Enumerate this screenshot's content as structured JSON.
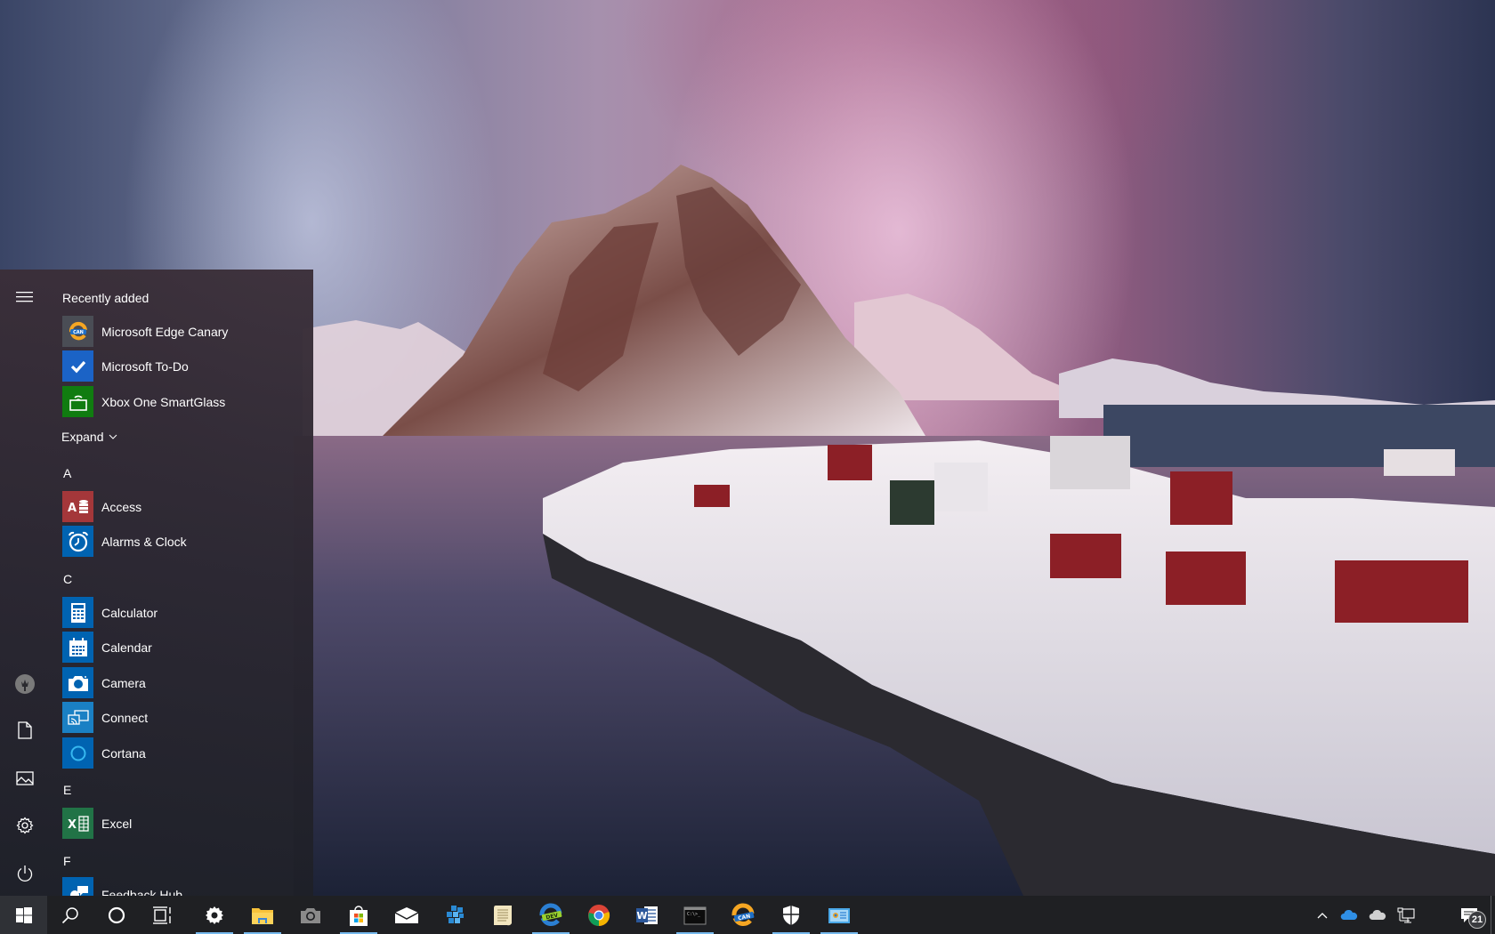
{
  "wallpaper": {
    "description": "Snowy mountain fishing village with red cabins at dusk under pink sky"
  },
  "start_menu": {
    "rail": [
      {
        "name": "menu",
        "icon": "hamburger-icon",
        "label": "Expand menu"
      },
      {
        "name": "user",
        "icon": "user-avatar-icon",
        "label": "User account"
      },
      {
        "name": "documents",
        "icon": "document-icon",
        "label": "Documents"
      },
      {
        "name": "pictures",
        "icon": "pictures-icon",
        "label": "Pictures"
      },
      {
        "name": "settings",
        "icon": "gear-icon",
        "label": "Settings"
      },
      {
        "name": "power",
        "icon": "power-icon",
        "label": "Power"
      }
    ],
    "recently_added_label": "Recently added",
    "recently_added": [
      {
        "label": "Microsoft Edge Canary",
        "icon": "edge-canary-icon",
        "tile_color": "#4a4d55"
      },
      {
        "label": "Microsoft To-Do",
        "icon": "checkmark-icon",
        "tile_color": "#1b63c6"
      },
      {
        "label": "Xbox One SmartGlass",
        "icon": "smartglass-icon",
        "tile_color": "#107c10"
      }
    ],
    "expand_label": "Expand",
    "groups": [
      {
        "letter": "A",
        "apps": [
          {
            "label": "Access",
            "icon": "access-icon",
            "tile_color": "#a4373a"
          },
          {
            "label": "Alarms & Clock",
            "icon": "alarm-clock-icon",
            "tile_color": "#0063b1"
          }
        ]
      },
      {
        "letter": "C",
        "apps": [
          {
            "label": "Calculator",
            "icon": "calculator-icon",
            "tile_color": "#0063b1"
          },
          {
            "label": "Calendar",
            "icon": "calendar-icon",
            "tile_color": "#0063b1"
          },
          {
            "label": "Camera",
            "icon": "camera-icon",
            "tile_color": "#0063b1"
          },
          {
            "label": "Connect",
            "icon": "connect-icon",
            "tile_color": "#1a80c4"
          },
          {
            "label": "Cortana",
            "icon": "cortana-icon",
            "tile_color": "#0063b1"
          }
        ]
      },
      {
        "letter": "E",
        "apps": [
          {
            "label": "Excel",
            "icon": "excel-icon",
            "tile_color": "#217346"
          }
        ]
      },
      {
        "letter": "F",
        "apps": [
          {
            "label": "Feedback Hub",
            "icon": "feedback-hub-icon",
            "tile_color": "#0063b1"
          }
        ]
      }
    ]
  },
  "taskbar": {
    "start": {
      "icon": "windows-logo-icon",
      "label": "Start"
    },
    "search": {
      "icon": "search-icon",
      "label": "Search"
    },
    "cortana": {
      "icon": "cortana-ring-icon",
      "label": "Cortana"
    },
    "task_view": {
      "icon": "task-view-icon",
      "label": "Task View"
    },
    "apps": [
      {
        "name": "settings",
        "icon": "gear-icon",
        "running": true
      },
      {
        "name": "file-explorer",
        "icon": "folder-icon",
        "running": true
      },
      {
        "name": "camera",
        "icon": "camera-icon",
        "running": false
      },
      {
        "name": "microsoft-store",
        "icon": "store-icon",
        "running": true
      },
      {
        "name": "mail",
        "icon": "mail-icon",
        "running": false
      },
      {
        "name": "visual-studio-tool",
        "icon": "cube-cluster-icon",
        "running": false
      },
      {
        "name": "notepad",
        "icon": "scroll-icon",
        "running": false
      },
      {
        "name": "edge-dev",
        "icon": "edge-dev-icon",
        "running": true
      },
      {
        "name": "chrome",
        "icon": "chrome-icon",
        "running": false
      },
      {
        "name": "word",
        "icon": "word-icon",
        "running": false
      },
      {
        "name": "command-prompt",
        "icon": "terminal-icon",
        "running": true
      },
      {
        "name": "edge-canary",
        "icon": "edge-canary-icon",
        "running": false
      },
      {
        "name": "windows-security",
        "icon": "shield-icon",
        "running": true
      },
      {
        "name": "control-panel",
        "icon": "control-panel-icon",
        "running": true
      }
    ],
    "tray": {
      "overflow": {
        "icon": "chevron-up-icon"
      },
      "onedrive_personal": {
        "icon": "onedrive-blue-icon"
      },
      "onedrive_business": {
        "icon": "onedrive-gray-icon"
      },
      "network": {
        "icon": "network-icon"
      },
      "notifications": {
        "icon": "action-center-icon",
        "count": "21"
      }
    }
  }
}
